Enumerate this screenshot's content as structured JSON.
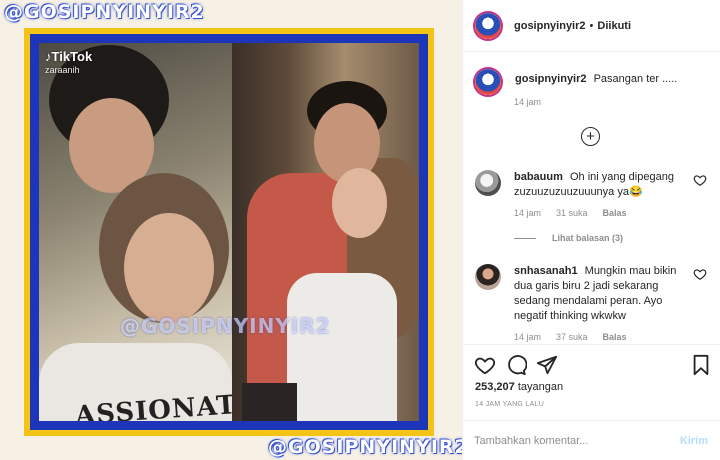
{
  "watermark": {
    "top": "@GOSIPNYINYIR2",
    "middle": "@GOSIPNYINYIR2",
    "bottom": "@GOSIPNYINYIR2"
  },
  "media": {
    "tiktok_label": "♪TikTok",
    "tiktok_user": "zaraanih",
    "shirt_text": "ASSIONATE"
  },
  "header": {
    "username": "gosipnyinyir2",
    "separator": "•",
    "follow_status": "Diikuti"
  },
  "caption": {
    "username": "gosipnyinyir2",
    "text": "Pasangan ter .....",
    "time": "14 jam"
  },
  "comments": [
    {
      "username": "babauum",
      "text": "Oh ini yang dipegang zuzuuzuzuuzuuunya ya😂",
      "time": "14 jam",
      "likes": "31 suka",
      "reply_label": "Balas",
      "view_replies": "Lihat balasan (3)"
    },
    {
      "username": "snhasanah1",
      "text": "Mungkin mau bikin dua garis biru 2 jadi sekarang sedang mendalami peran. Ayo negatif thinking wkwkw",
      "time": "14 jam",
      "likes": "37 suka",
      "reply_label": "Balas"
    }
  ],
  "stats": {
    "views_count": "253,207",
    "views_label": "tayangan",
    "post_date": "14 JAM YANG LALU"
  },
  "add_comment": {
    "placeholder": "Tambahkan komentar...",
    "post_label": "Kirim"
  },
  "icons": {
    "like": "heart-icon",
    "comment": "comment-icon",
    "share": "share-icon",
    "save": "bookmark-icon",
    "load_more": "plus-circle-icon"
  },
  "colors": {
    "frame_yellow": "#f3c316",
    "frame_blue": "#1d35b8",
    "post_button": "#b2dffc",
    "muted_text": "#8e8e8e"
  }
}
